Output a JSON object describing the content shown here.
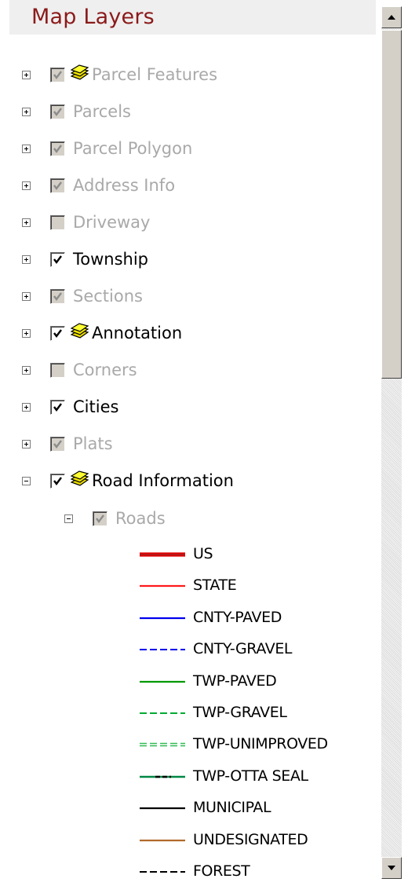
{
  "header": {
    "title": "Map Layers"
  },
  "layers": [
    {
      "label": "Parcel Features",
      "checked": true,
      "active": false,
      "icon": true,
      "expanded": false
    },
    {
      "label": "Parcels",
      "checked": true,
      "active": false,
      "icon": false,
      "expanded": false
    },
    {
      "label": "Parcel Polygon",
      "checked": true,
      "active": false,
      "icon": false,
      "expanded": false
    },
    {
      "label": "Address Info",
      "checked": true,
      "active": false,
      "icon": false,
      "expanded": false
    },
    {
      "label": "Driveway",
      "checked": false,
      "active": false,
      "icon": false,
      "expanded": false
    },
    {
      "label": "Township",
      "checked": true,
      "active": true,
      "icon": false,
      "expanded": false
    },
    {
      "label": "Sections",
      "checked": true,
      "active": false,
      "icon": false,
      "expanded": false
    },
    {
      "label": "Annotation",
      "checked": true,
      "active": true,
      "icon": true,
      "expanded": false
    },
    {
      "label": "Corners",
      "checked": false,
      "active": false,
      "icon": false,
      "expanded": false
    },
    {
      "label": "Cities",
      "checked": true,
      "active": true,
      "icon": false,
      "expanded": false
    },
    {
      "label": "Plats",
      "checked": true,
      "active": false,
      "icon": false,
      "expanded": false
    },
    {
      "label": "Road Information",
      "checked": true,
      "active": true,
      "icon": true,
      "expanded": true
    }
  ],
  "sublayer": {
    "label": "Roads",
    "checked": true,
    "active": false,
    "expanded": true
  },
  "legend": [
    {
      "label": "US",
      "color": "#e00000",
      "style": "double"
    },
    {
      "label": "STATE",
      "color": "#ff1a1a",
      "style": "solid"
    },
    {
      "label": "CNTY-PAVED",
      "color": "#0000ee",
      "style": "solid"
    },
    {
      "label": "CNTY-GRAVEL",
      "color": "#0000ee",
      "style": "dashed"
    },
    {
      "label": "TWP-PAVED",
      "color": "#009900",
      "style": "solid"
    },
    {
      "label": "TWP-GRAVEL",
      "color": "#00aa33",
      "style": "dashed"
    },
    {
      "label": "TWP-UNIMPROVED",
      "color": "#33bb55",
      "style": "double-dashed"
    },
    {
      "label": "TWP-OTTA SEAL",
      "color": "#008844",
      "style": "dash-dot"
    },
    {
      "label": "MUNICIPAL",
      "color": "#000000",
      "style": "solid"
    },
    {
      "label": "UNDESIGNATED",
      "color": "#b06a2a",
      "style": "solid"
    },
    {
      "label": "FOREST",
      "color": "#000000",
      "style": "dashed"
    }
  ]
}
